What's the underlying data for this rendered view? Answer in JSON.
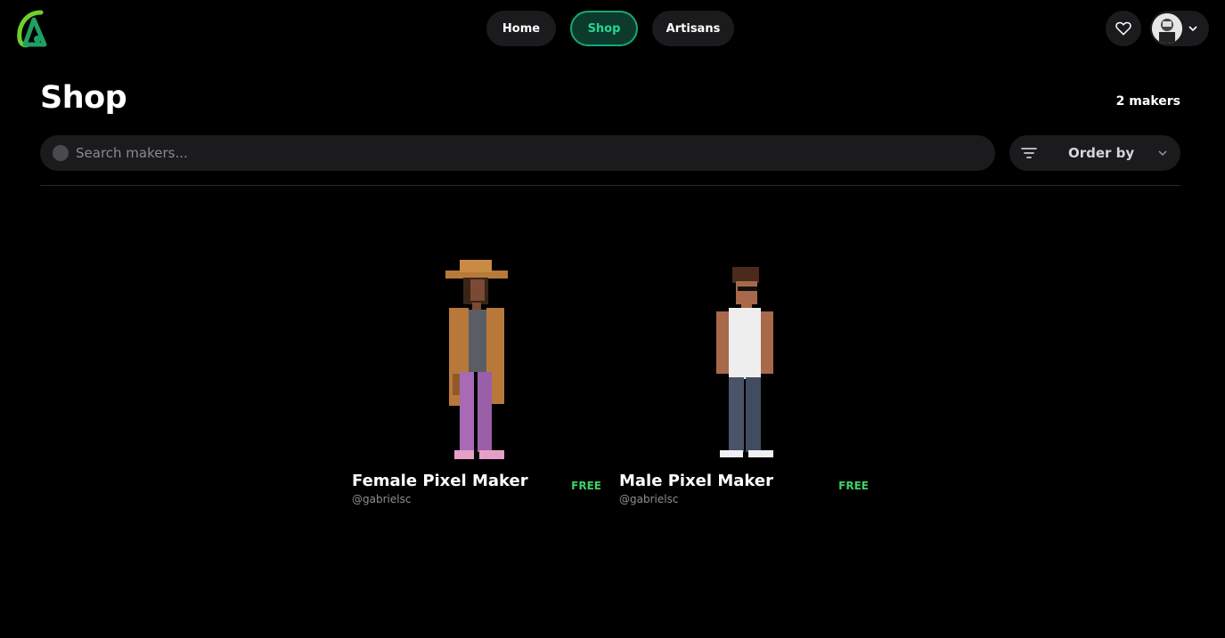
{
  "nav": {
    "home": "Home",
    "shop": "Shop",
    "artisans": "Artisans"
  },
  "page": {
    "title": "Shop",
    "count": "2 makers"
  },
  "search": {
    "placeholder": "Search makers..."
  },
  "order": {
    "label": "Order by"
  },
  "products": [
    {
      "name": "Female Pixel Maker",
      "author": "@gabrielsc",
      "price": "FREE"
    },
    {
      "name": "Male Pixel Maker",
      "author": "@gabrielsc",
      "price": "FREE"
    }
  ],
  "colors": {
    "accent": "#27d494",
    "price": "#3fcf6a",
    "surface": "#1b1b1d"
  }
}
